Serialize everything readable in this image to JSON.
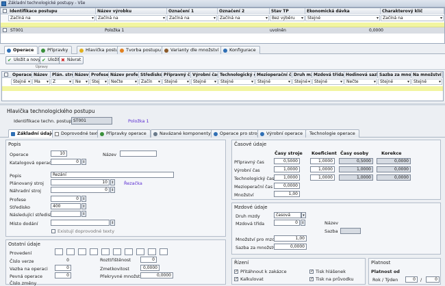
{
  "window": {
    "title": "Základní technologické postupy - Vše"
  },
  "top_grid": {
    "columns": [
      "Identifikace postupu",
      "Název výrobku",
      "Označení 1",
      "Označení 2",
      "Stav TP",
      "Ekonomická dávka",
      "Charakterový klíč"
    ],
    "filters": [
      "Začíná na",
      "Začíná na",
      "Začíná na",
      "Začíná na",
      "Bez výběru",
      "Stejné",
      "Začíná na"
    ],
    "row": {
      "id": "ST001",
      "name": "Položka 1",
      "stav": "uvolněn",
      "davka": "0,0000"
    }
  },
  "main_tabs": [
    "Operace",
    "Přípravky",
    "Hlavička postupu",
    "Tvorba postupu",
    "Varianty dle množství",
    "Konfigurace"
  ],
  "toolbar": {
    "save_new": "Uložit a nový",
    "save": "Uložit",
    "back": "Návrat",
    "group": "Úpravy"
  },
  "op_grid": {
    "columns": [
      "Operace",
      "Název",
      "Plán. stroj",
      "Název",
      "Profese",
      "Název profese",
      "Středisko",
      "Přípravný čas",
      "Výrobní čas",
      "Technologický čas",
      "Mezioperační čas",
      "Druh mzdy",
      "Mzdová třída",
      "Hodinová sazba",
      "Sazba za množ.",
      "Na množství"
    ],
    "filters": [
      "Stejné",
      "Ma",
      "Z",
      "Ne",
      "Stej",
      "Nečte",
      "Začín",
      "Stejné",
      "Stejné",
      "Stejné",
      "Stejné",
      "Stejné",
      "Stejné",
      "Nečte",
      "Stejné",
      "Stejné"
    ]
  },
  "header": {
    "section": "Hlavička technologického postupu",
    "id_label": "Identifikace techn. postupu",
    "id_value": "ST001",
    "item": "Položka 1"
  },
  "sub_tabs": [
    "Základní údaje",
    "Doprovodné texty",
    "Přípravky operace",
    "Navázané komponenty",
    "Operace pro stroj",
    "Výrobní operace",
    "Technologie operace"
  ],
  "popis": {
    "title": "Popis",
    "operace_label": "Operace",
    "operace_value": "10",
    "nazev_label": "Název",
    "katalog_label": "Katalogová operace",
    "katalog_value": "0",
    "popis_label": "Popis",
    "popis_value": "Řezání",
    "stroj_label": "Plánovaný stroj",
    "stroj_value": "10",
    "stroj_name": "Řezačka",
    "nahr_label": "Náhradní stroj",
    "nahr_value": "0",
    "profese_label": "Profese",
    "profese_value": "0",
    "stredisko_label": "Středisko",
    "stredisko_value": "400",
    "nasl_label": "Následující středisko",
    "misto_label": "Místo dodání",
    "exist_label": "Existují doprovodné texty"
  },
  "ostatni": {
    "title": "Ostatní údaje",
    "provedeni": "Provedení",
    "cislo_verze": "Číslo verze",
    "cislo_verze_value": "0",
    "vazba": "Vazba na operaci",
    "vazba_value": "0",
    "pevna": "Pevná operace",
    "pevna_value": "0",
    "cislo_zmeny": "Číslo změny",
    "rozt": "Rozttřištěnost",
    "rozt_value": "0",
    "zmet": "Zmetkovitost",
    "zmet_value": "0,0000",
    "prekr": "Překryvné množství",
    "prekr_value": "0,0000"
  },
  "casove": {
    "title": "Časové údaje",
    "col_stroje": "Časy stroje",
    "col_koef": "Koeficient",
    "col_osoby": "Časy osoby",
    "col_korekce": "Korekce",
    "rows": [
      {
        "label": "Přípravný čas",
        "stroj": "0,5000",
        "koef": "1,0000",
        "osoby": "0,5000",
        "korekce": "0,0000"
      },
      {
        "label": "Výrobní čas",
        "stroj": "1,0000",
        "koef": "1,0000",
        "osoby": "1,0000",
        "korekce": "0,0000"
      },
      {
        "label": "Technologický čas",
        "stroj": "1,0000",
        "koef": "1,0000",
        "osoby": "1,0000",
        "korekce": "0,0000"
      },
      {
        "label": "Mezioperační čas",
        "stroj": "0,0000"
      },
      {
        "label": "Množství",
        "stroj": "1,00"
      }
    ]
  },
  "mzdove": {
    "title": "Mzdové údaje",
    "druh": "Druh mzdy",
    "druh_value": "časová",
    "trida": "Mzdová třída",
    "trida_value": "0",
    "nazev": "Název",
    "sazba": "Sazba",
    "mnozstvi": "Množství pro mzdu",
    "mnozstvi_value": "1,00",
    "sazba_mn": "Sazba za množství",
    "sazba_mn_value": "0,0000"
  },
  "rizeni": {
    "title": "Řízení",
    "items": [
      "Přitáhnout k zakázce",
      "Tisk hlášenek",
      "Kalkulovat",
      "Tisk na průvodku"
    ]
  },
  "platnost": {
    "title": "Platnost",
    "od": "Platnost od",
    "rok": "Rok / Týden",
    "rok_value": "0",
    "tyden_value": "0"
  },
  "colors": {
    "selected_row": "#f2f5a0",
    "accent": "#2f6fb4",
    "link": "#5a2bd1"
  }
}
